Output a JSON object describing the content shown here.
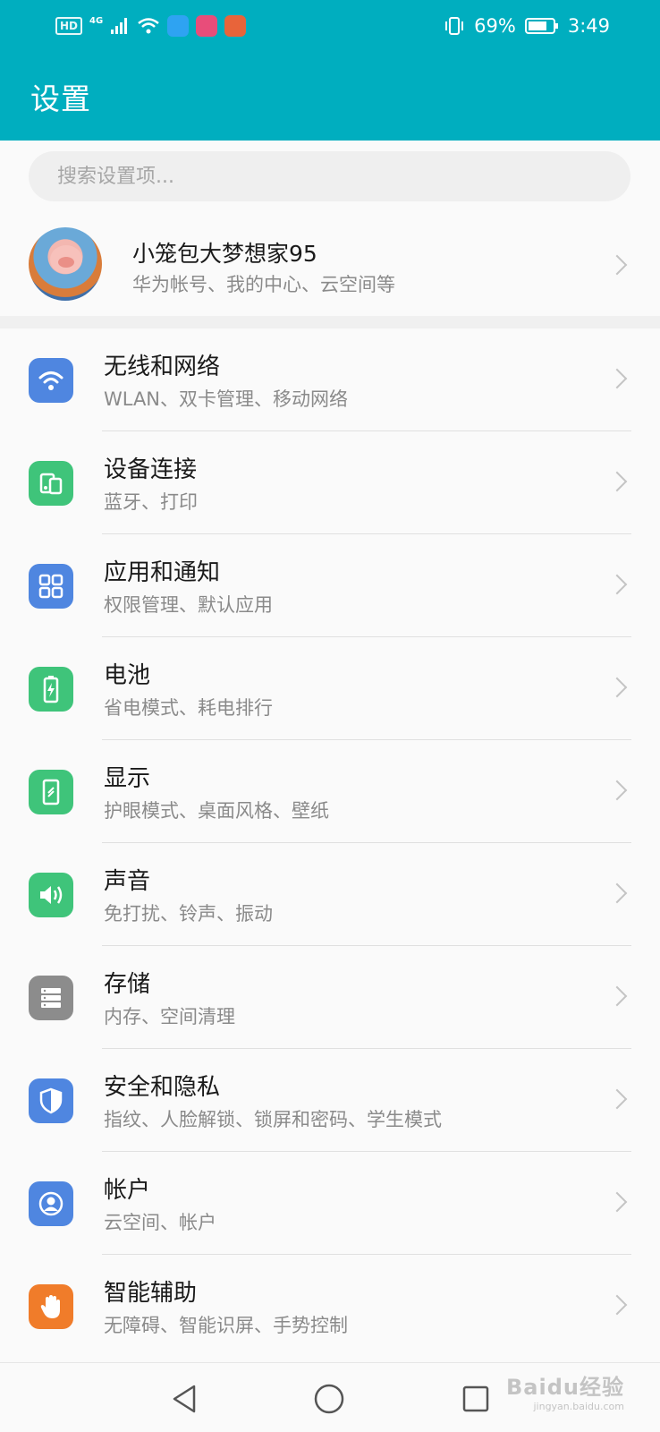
{
  "status_bar": {
    "hd": "HD",
    "network": "4G",
    "battery": "69%",
    "time": "3:49"
  },
  "header": {
    "title": "设置"
  },
  "search": {
    "placeholder": "搜索设置项..."
  },
  "profile": {
    "name": "小笼包大梦想家95",
    "subtitle": "华为帐号、我的中心、云空间等"
  },
  "settings": [
    {
      "title": "无线和网络",
      "subtitle": "WLAN、双卡管理、移动网络",
      "icon": "wifi-icon",
      "color": "#4f86e0"
    },
    {
      "title": "设备连接",
      "subtitle": "蓝牙、打印",
      "icon": "device-connection-icon",
      "color": "#3fc47a"
    },
    {
      "title": "应用和通知",
      "subtitle": "权限管理、默认应用",
      "icon": "apps-grid-icon",
      "color": "#4f86e0"
    },
    {
      "title": "电池",
      "subtitle": "省电模式、耗电排行",
      "icon": "battery-icon",
      "color": "#3fc47a"
    },
    {
      "title": "显示",
      "subtitle": "护眼模式、桌面风格、壁纸",
      "icon": "display-icon",
      "color": "#3fc47a"
    },
    {
      "title": "声音",
      "subtitle": "免打扰、铃声、振动",
      "icon": "sound-icon",
      "color": "#3fc47a"
    },
    {
      "title": "存储",
      "subtitle": "内存、空间清理",
      "icon": "storage-icon",
      "color": "#8c8c8c"
    },
    {
      "title": "安全和隐私",
      "subtitle": "指纹、人脸解锁、锁屏和密码、学生模式",
      "icon": "shield-icon",
      "color": "#4f86e0"
    },
    {
      "title": "帐户",
      "subtitle": "云空间、帐户",
      "icon": "account-icon",
      "color": "#4f86e0"
    },
    {
      "title": "智能辅助",
      "subtitle": "无障碍、智能识屏、手势控制",
      "icon": "hand-icon",
      "color": "#f07c2a"
    }
  ],
  "watermark": {
    "brand": "Baidu经验",
    "url": "jingyan.baidu.com"
  }
}
